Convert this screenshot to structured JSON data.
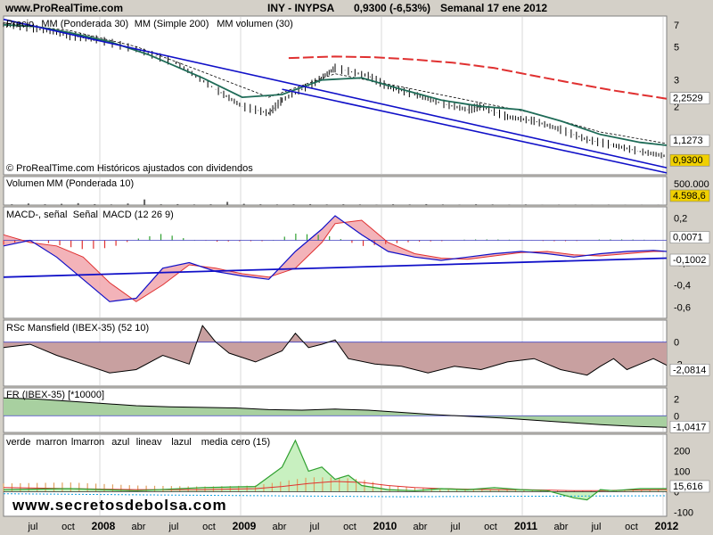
{
  "header": {
    "site": "www.ProRealTime.com",
    "ticker": "INY - INYPSA",
    "quote": "0,9300 (-6,53%)",
    "period": "Semanal  17 ene 2012"
  },
  "watermark": "www.secretosdebolsa.com",
  "copyright": "© ProRealTime.com Históricos ajustados con dividendos",
  "colors": {
    "background": "#ffffff",
    "frame": "#d4d0c8",
    "price": "#000000",
    "mm30": "#1e6b57",
    "mm200": "#e03030",
    "trendline": "#1010c8",
    "macd_pos_fill": "#f0a0a8",
    "macd_neg_fill": "#b8e0a8",
    "rsc_fill": "#c8a0a0",
    "fr_fill_pos": "#a8d0a0",
    "fr_fill_neg": "#c8a8c0",
    "highlight_price": "#f0d000",
    "green": "#30a030"
  },
  "x_axis": {
    "labels": [
      "jul",
      "oct",
      "2008",
      "abr",
      "jul",
      "oct",
      "2009",
      "abr",
      "jul",
      "oct",
      "2010",
      "abr",
      "jul",
      "oct",
      "2011",
      "abr",
      "jul",
      "oct",
      "2012"
    ]
  },
  "chart_data": [
    {
      "type": "line",
      "panel": "price",
      "legend": [
        {
          "text": "Precio",
          "color": "#000000"
        },
        {
          "text": "MM (Ponderada 30)",
          "color": "#1e6b57"
        },
        {
          "text": "MM (Simple 200)",
          "color": "#e03030"
        },
        {
          "text": "MM volumen (30)",
          "color": "#000000"
        }
      ],
      "y_ticks": [
        "7",
        "5",
        "3",
        "2"
      ],
      "scale": "log",
      "tags": [
        {
          "text": "2,2529",
          "color": "#e03030"
        },
        {
          "text": "1,1273",
          "color": "#000000"
        },
        {
          "text": "0,9300",
          "color": "#000000",
          "highlight": true
        }
      ],
      "series": [
        {
          "name": "Precio",
          "x": [
            0,
            5,
            10,
            14,
            20,
            26,
            32,
            36,
            40,
            42,
            47,
            50,
            55,
            58,
            62,
            66,
            70,
            72,
            76,
            80,
            84,
            88,
            92,
            96,
            100
          ],
          "y": [
            7.0,
            6.6,
            5.9,
            5.6,
            4.8,
            3.9,
            2.6,
            2.0,
            1.8,
            2.2,
            2.9,
            3.6,
            3.2,
            2.7,
            2.4,
            2.1,
            1.9,
            2.0,
            1.7,
            1.6,
            1.4,
            1.2,
            1.1,
            1.0,
            0.93
          ]
        },
        {
          "name": "MM (Ponderada 30)",
          "x": [
            0,
            5,
            10,
            16,
            22,
            30,
            36,
            42,
            48,
            54,
            60,
            66,
            72,
            78,
            84,
            90,
            96,
            100
          ],
          "y": [
            7.0,
            6.8,
            6.2,
            5.4,
            4.4,
            3.1,
            2.3,
            2.4,
            3.0,
            3.1,
            2.6,
            2.2,
            2.0,
            1.9,
            1.6,
            1.3,
            1.15,
            1.1
          ]
        },
        {
          "name": "MM (Simple 200)",
          "x": [
            43,
            50,
            56,
            62,
            68,
            74,
            80,
            86,
            92,
            100
          ],
          "y": [
            4.2,
            4.3,
            4.25,
            4.1,
            3.9,
            3.6,
            3.2,
            2.85,
            2.55,
            2.25
          ]
        },
        {
          "name": "MM volumen (30)",
          "x": [
            0,
            10,
            20,
            30,
            40,
            50,
            60,
            70,
            80,
            90,
            100
          ],
          "y": [
            7.2,
            6.4,
            5.0,
            3.4,
            2.3,
            3.3,
            2.7,
            2.2,
            1.8,
            1.35,
            1.13
          ]
        }
      ],
      "trendlines": [
        {
          "x": [
            0,
            100
          ],
          "y": [
            7.6,
            0.78
          ]
        },
        {
          "x": [
            42,
            100
          ],
          "y": [
            2.6,
            0.72
          ]
        }
      ]
    },
    {
      "type": "bar",
      "panel": "volume",
      "legend": [
        {
          "text": "Volumen",
          "color": "#e03030"
        },
        {
          "text": "MM (Ponderada 10)",
          "color": "#1010c8"
        }
      ],
      "y_ticks": [
        "500.000"
      ],
      "tags": [
        {
          "text": "4.598,6",
          "color": "#000000",
          "highlight": true
        }
      ],
      "values": [
        0.05,
        0.1,
        0.05,
        0.08,
        0.12,
        0.06,
        0.04,
        0.1,
        0.35,
        0.05,
        0.06,
        0.04,
        0.05,
        0.2,
        0.08,
        0.05,
        0.04,
        0.05,
        0.06,
        0.04,
        0.05,
        0.04,
        0.03,
        0.05,
        0.04,
        0.06,
        0.04,
        0.03,
        0.05,
        0.04,
        0.03,
        0.04,
        0.02,
        0.03,
        0.03,
        0.02,
        0.03,
        0.02,
        0.02,
        0.02
      ]
    },
    {
      "type": "area",
      "panel": "macd",
      "legend": [
        {
          "text": "MACD-, señal",
          "color": "#30a030"
        },
        {
          "text": "Señal",
          "color": "#e03030"
        },
        {
          "text": "MACD (12 26 9)",
          "color": "#1010c8"
        }
      ],
      "y_ticks": [
        "0,2",
        "-0,2",
        "-0,4",
        "-0,6"
      ],
      "tags": [
        {
          "text": "0,0071",
          "color": "#30a030"
        },
        {
          "text": "-0,1002",
          "color": "#000000"
        }
      ],
      "ylim": [
        -0.7,
        0.3
      ],
      "series": [
        {
          "name": "MACD",
          "x": [
            0,
            4,
            8,
            12,
            16,
            20,
            24,
            28,
            32,
            36,
            40,
            44,
            48,
            50,
            54,
            58,
            62,
            66,
            70,
            74,
            78,
            82,
            86,
            90,
            94,
            98,
            100
          ],
          "y": [
            -0.05,
            0.0,
            -0.15,
            -0.35,
            -0.55,
            -0.52,
            -0.25,
            -0.2,
            -0.28,
            -0.32,
            -0.35,
            -0.1,
            0.1,
            0.22,
            0.05,
            -0.1,
            -0.15,
            -0.18,
            -0.15,
            -0.12,
            -0.1,
            -0.12,
            -0.15,
            -0.12,
            -0.1,
            -0.09,
            -0.1
          ]
        },
        {
          "name": "Señal",
          "x": [
            0,
            4,
            8,
            12,
            16,
            20,
            24,
            28,
            32,
            36,
            40,
            44,
            48,
            50,
            54,
            58,
            62,
            66,
            70,
            74,
            78,
            82,
            86,
            90,
            94,
            98,
            100
          ],
          "y": [
            0.05,
            -0.02,
            -0.05,
            -0.15,
            -0.38,
            -0.55,
            -0.4,
            -0.22,
            -0.25,
            -0.3,
            -0.33,
            -0.25,
            -0.02,
            0.15,
            0.18,
            -0.02,
            -0.12,
            -0.16,
            -0.17,
            -0.14,
            -0.11,
            -0.1,
            -0.13,
            -0.14,
            -0.12,
            -0.1,
            -0.1
          ]
        }
      ],
      "trendlines": [
        {
          "x": [
            0,
            100
          ],
          "y": [
            -0.33,
            -0.16
          ]
        }
      ]
    },
    {
      "type": "area",
      "panel": "rsc",
      "legend": [
        {
          "text": "RSc Mansfield (IBEX-35) (52 10)",
          "color": "#000000"
        }
      ],
      "y_ticks": [
        "0",
        "-2"
      ],
      "tags": [
        {
          "text": "-2,0814",
          "color": "#000000"
        }
      ],
      "ylim": [
        -4,
        2
      ],
      "series": [
        {
          "name": "RSc Mansfield",
          "x": [
            0,
            4,
            8,
            12,
            16,
            20,
            24,
            28,
            30,
            32,
            34,
            38,
            42,
            44,
            46,
            48,
            50,
            52,
            56,
            60,
            64,
            68,
            72,
            76,
            80,
            84,
            88,
            90,
            92,
            94,
            96,
            98,
            100
          ],
          "y": [
            -0.5,
            -0.2,
            -1.2,
            -2.0,
            -2.8,
            -2.5,
            -1.2,
            -2.0,
            1.5,
            0.0,
            -1.0,
            -1.8,
            -0.8,
            0.8,
            -0.5,
            -0.2,
            0.2,
            -1.5,
            -2.0,
            -2.2,
            -2.8,
            -2.2,
            -2.5,
            -1.8,
            -1.5,
            -2.5,
            -3.0,
            -2.2,
            -1.5,
            -2.5,
            -2.0,
            -1.5,
            -2.1
          ]
        }
      ]
    },
    {
      "type": "area",
      "panel": "fr",
      "legend": [
        {
          "text": "FR (IBEX-35) [*10000]",
          "color": "#000000"
        }
      ],
      "y_ticks": [
        "2",
        "0"
      ],
      "tags": [
        {
          "text": "-1,0417",
          "color": "#000000"
        }
      ],
      "ylim": [
        -1.5,
        2.5
      ],
      "series": [
        {
          "name": "FR",
          "x": [
            0,
            5,
            10,
            15,
            20,
            25,
            30,
            35,
            40,
            45,
            50,
            55,
            60,
            65,
            70,
            75,
            80,
            85,
            90,
            95,
            100
          ],
          "y": [
            1.6,
            1.5,
            1.3,
            1.1,
            0.9,
            0.8,
            0.75,
            0.7,
            0.55,
            0.5,
            0.6,
            0.5,
            0.3,
            0.1,
            -0.05,
            -0.2,
            -0.4,
            -0.6,
            -0.8,
            -0.95,
            -1.04
          ]
        }
      ]
    },
    {
      "type": "line",
      "panel": "oscillator",
      "legend": [
        {
          "text": "verde",
          "color": "#30c030"
        },
        {
          "text": "marron",
          "color": "#e0a060"
        },
        {
          "text": "lmarron",
          "color": "#000000"
        },
        {
          "text": "azul",
          "color": "#10a0e0"
        },
        {
          "text": "lineav",
          "color": "#000000"
        },
        {
          "text": "lazul",
          "color": "#000000"
        },
        {
          "text": "media",
          "color": "#e03030"
        },
        {
          "text": "cero (15)",
          "color": "#000000"
        }
      ],
      "y_ticks": [
        "200",
        "100",
        "0",
        "-100"
      ],
      "tags": [
        {
          "text": "15,616",
          "color": "#30c030"
        }
      ],
      "ylim": [
        -120,
        280
      ],
      "series": [
        {
          "name": "verde",
          "x": [
            0,
            10,
            20,
            30,
            38,
            42,
            44,
            46,
            48,
            50,
            52,
            54,
            58,
            62,
            66,
            70,
            74,
            78,
            82,
            86,
            88,
            90,
            92,
            96,
            100
          ],
          "y": [
            10,
            15,
            5,
            20,
            25,
            120,
            250,
            100,
            120,
            60,
            80,
            30,
            10,
            5,
            15,
            10,
            20,
            10,
            5,
            -30,
            -40,
            10,
            5,
            15,
            15
          ]
        },
        {
          "name": "marron",
          "x": [
            0,
            10,
            20,
            30,
            38,
            42,
            46,
            50,
            54,
            58,
            62,
            66,
            70,
            74,
            78,
            82,
            86,
            90,
            94,
            100
          ],
          "y": [
            40,
            45,
            30,
            25,
            30,
            50,
            70,
            70,
            60,
            30,
            20,
            15,
            10,
            10,
            10,
            10,
            5,
            5,
            10,
            10
          ]
        },
        {
          "name": "media",
          "x": [
            0,
            10,
            20,
            30,
            38,
            42,
            46,
            50,
            54,
            58,
            62,
            66,
            70,
            74,
            78,
            82,
            86,
            90,
            94,
            100
          ],
          "y": [
            20,
            15,
            10,
            10,
            15,
            25,
            40,
            50,
            45,
            30,
            20,
            15,
            12,
            10,
            10,
            8,
            5,
            5,
            8,
            10
          ]
        },
        {
          "name": "azul",
          "x": [
            0,
            20,
            40,
            60,
            80,
            100
          ],
          "y": [
            -10,
            -15,
            -20,
            -25,
            -22,
            -20
          ]
        }
      ]
    }
  ]
}
